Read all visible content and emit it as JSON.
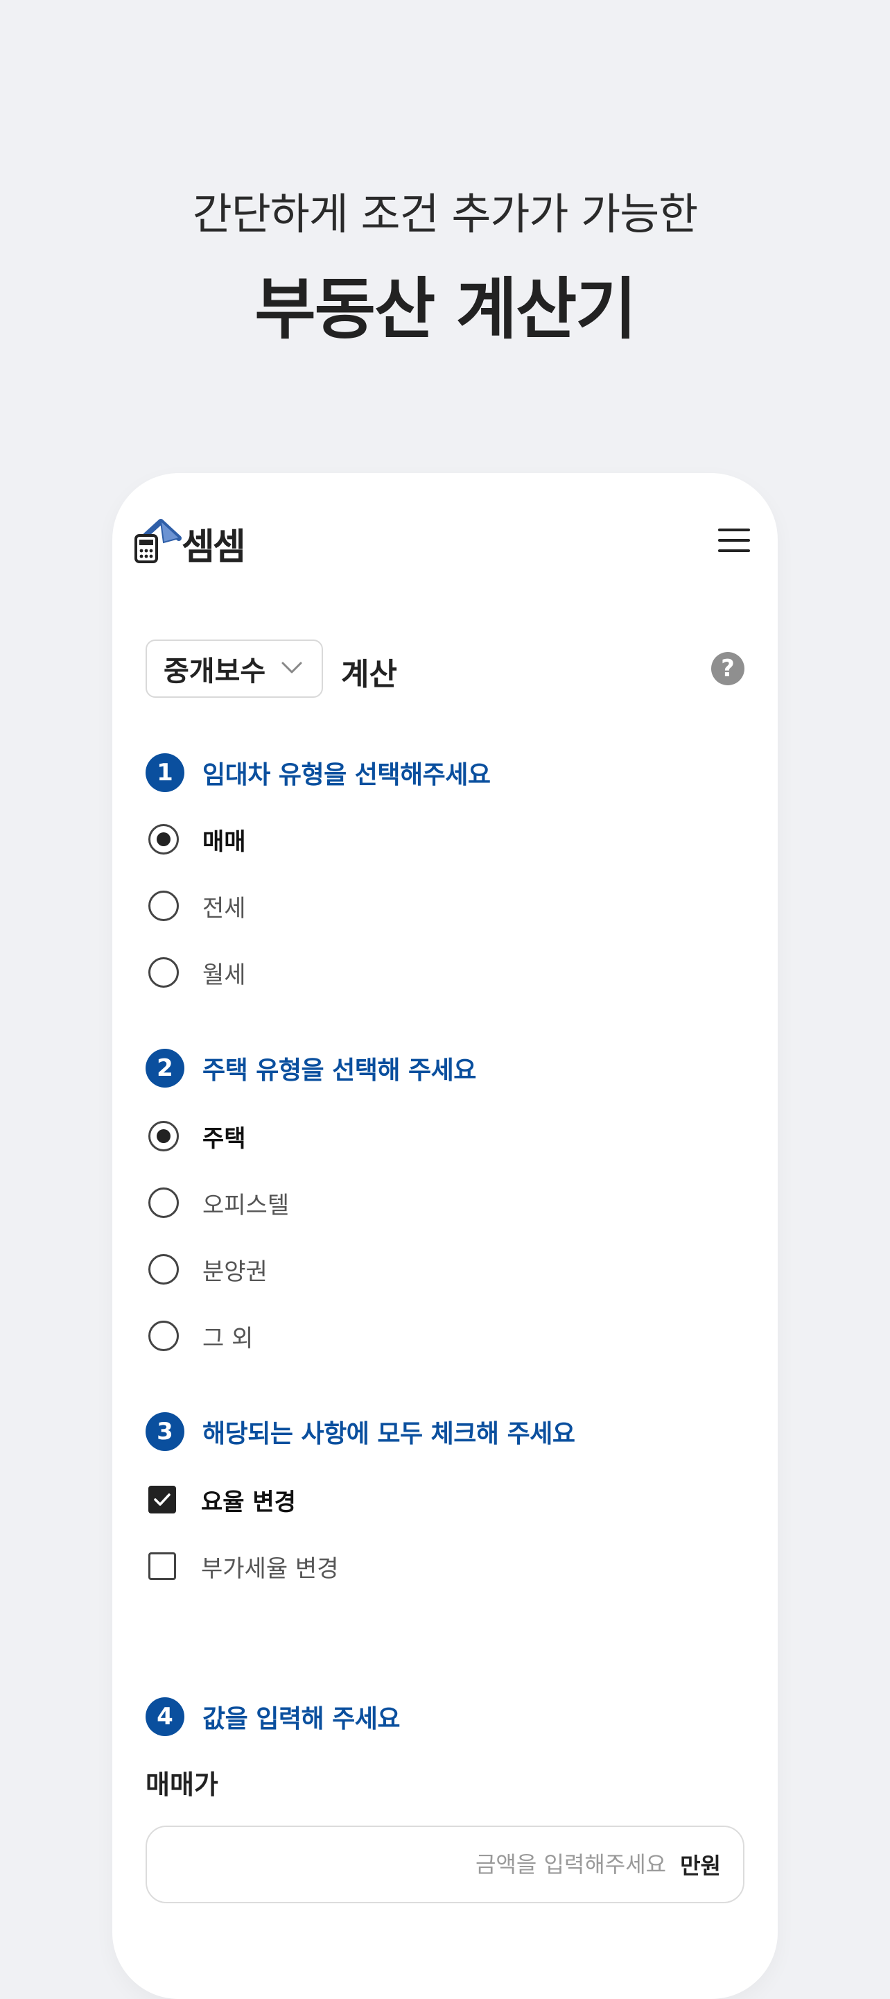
{
  "headline": {
    "subtitle": "간단하게 조건 추가가 가능한",
    "title": "부동산 계산기"
  },
  "app": {
    "logo_text": "셈셈",
    "menu_icon": "hamburger-icon"
  },
  "calculator": {
    "selected_type": "중개보수",
    "label": "계산",
    "help_symbol": "?"
  },
  "sections": [
    {
      "number": "1",
      "title": "임대차 유형을 선택해주세요",
      "options": [
        {
          "label": "매매",
          "selected": true
        },
        {
          "label": "전세",
          "selected": false
        },
        {
          "label": "월세",
          "selected": false
        }
      ]
    },
    {
      "number": "2",
      "title": "주택 유형을 선택해 주세요",
      "options": [
        {
          "label": "주택",
          "selected": true
        },
        {
          "label": "오피스텔",
          "selected": false
        },
        {
          "label": "분양권",
          "selected": false
        },
        {
          "label": "그 외",
          "selected": false
        }
      ]
    },
    {
      "number": "3",
      "title": "해당되는 사항에 모두 체크해 주세요",
      "options": [
        {
          "label": "요율 변경",
          "checked": true
        },
        {
          "label": "부가세율 변경",
          "checked": false
        }
      ]
    },
    {
      "number": "4",
      "title": "값을 입력해 주세요"
    }
  ],
  "price_field": {
    "label": "매매가",
    "placeholder": "금액을 입력해주세요",
    "unit": "만원"
  },
  "colors": {
    "accent": "#0a4f9e",
    "background": "#f0f1f4",
    "card": "#ffffff"
  }
}
